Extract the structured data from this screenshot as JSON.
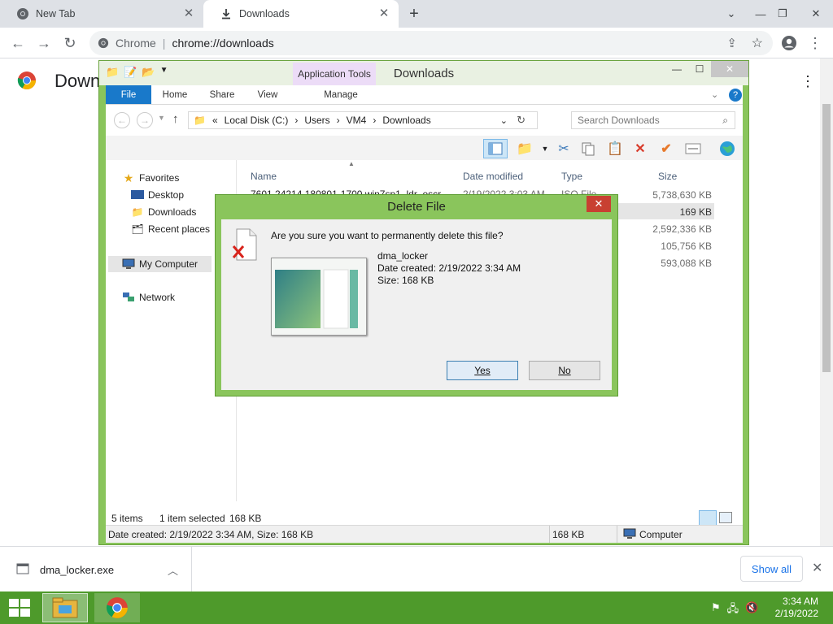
{
  "browser": {
    "tabs": [
      {
        "label": "New Tab",
        "icon": "chrome-icon"
      },
      {
        "label": "Downloads",
        "icon": "download-icon"
      }
    ],
    "omnibox": {
      "chip": "Chrome",
      "url": "chrome://downloads"
    },
    "page_title": "Downloads"
  },
  "download_shelf": {
    "item_name": "dma_locker.exe",
    "show_all_label": "Show all"
  },
  "explorer": {
    "title": "Downloads",
    "app_tools_label": "Application Tools",
    "ribbon_tabs": [
      "File",
      "Home",
      "Share",
      "View",
      "Manage"
    ],
    "breadcrumb": [
      "Local Disk (C:)",
      "Users",
      "VM4",
      "Downloads"
    ],
    "breadcrumb_prefix": "«",
    "search_placeholder": "Search Downloads",
    "nav": {
      "favorites": "Favorites",
      "desktop": "Desktop",
      "downloads": "Downloads",
      "recent": "Recent places",
      "computer": "My Computer",
      "network": "Network"
    },
    "columns": {
      "name": "Name",
      "date": "Date modified",
      "type": "Type",
      "size": "Size"
    },
    "row1": {
      "name": "7601.24214.180801-1700.win7sp1_ldr_escr",
      "date": "2/19/2022 3:03 AM",
      "type": "ISO File"
    },
    "sizes": [
      "5,738,630 KB",
      "169 KB",
      "2,592,336 KB",
      "105,756 KB",
      "593,088 KB"
    ],
    "status": {
      "items": "5 items",
      "selected": "1 item selected",
      "selected_size": "168 KB"
    },
    "details": {
      "text": "Date created: 2/19/2022 3:34 AM, Size: 168 KB",
      "size": "168 KB",
      "location": "Computer"
    }
  },
  "dialog": {
    "title": "Delete File",
    "question": "Are you sure you want to permanently delete this file?",
    "file_name": "dma_locker",
    "date_created": "Date created: 2/19/2022 3:34 AM",
    "size": "Size: 168 KB",
    "yes_label": "Yes",
    "no_label": "No"
  },
  "taskbar": {
    "time": "3:34 AM",
    "date": "2/19/2022"
  },
  "colors": {
    "taskbar": "#4e9a2b",
    "window_frame": "#8ac55c",
    "file_tab": "#1979ca",
    "close_red": "#c84031",
    "link_blue": "#1a73e8"
  }
}
